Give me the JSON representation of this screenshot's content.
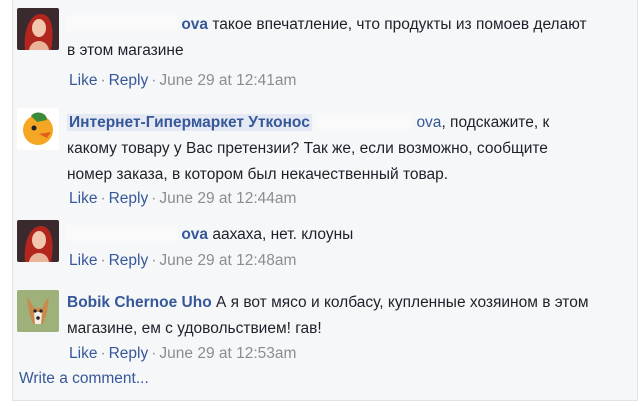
{
  "comments": [
    {
      "author": "ova",
      "text": "такое впечатление, что продукты из помоев делают в этом магазине",
      "like": "Like",
      "reply": "Reply",
      "time": "June 29 at 12:41am"
    },
    {
      "author": "Интернет-Гипермаркет Утконос",
      "mention": "ova",
      "text": ", подскажите, к какому товару у Вас претензии? Так же, если возможно, сообщите номер заказа, в котором был некачественный товар.",
      "like": "Like",
      "reply": "Reply",
      "time": "June 29 at 12:44am"
    },
    {
      "author": "ova",
      "text": "аахаха, нет. клоуны",
      "like": "Like",
      "reply": "Reply",
      "time": "June 29 at 12:48am"
    },
    {
      "author": "Bobik Chernoe Uho",
      "text": "А я вот мясо и колбасу, купленные хозяином в этом магазине, ем с удовольствием! гав!",
      "like": "Like",
      "reply": "Reply",
      "time": "June 29 at 12:53am"
    }
  ],
  "write_comment": "Write a comment...",
  "colors": {
    "link": "#365899",
    "meta": "#8a8d91",
    "text": "#1d2129",
    "background": "#f6f7f9"
  }
}
